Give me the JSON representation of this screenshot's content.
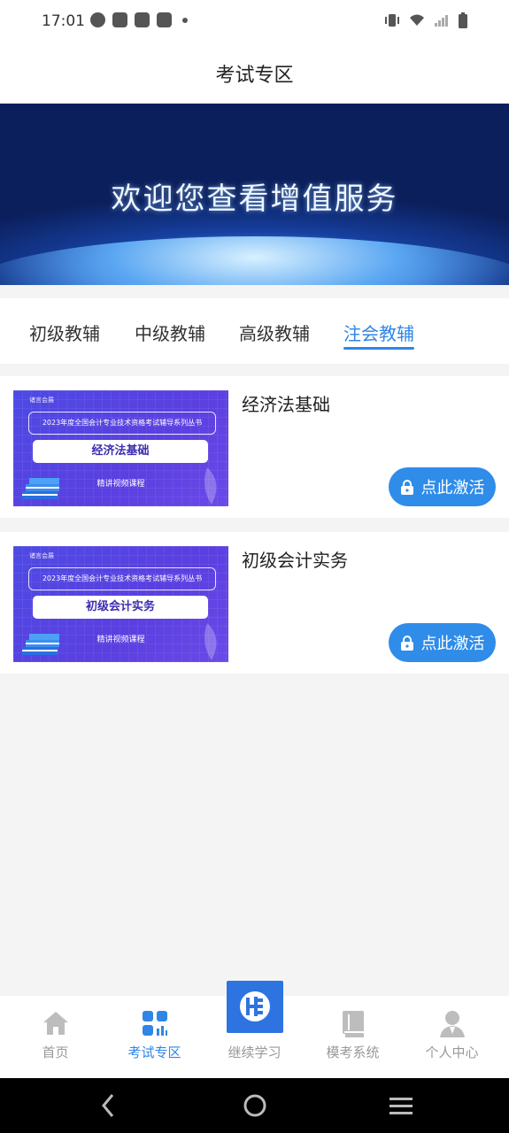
{
  "status_bar": {
    "time": "17:01"
  },
  "header": {
    "title": "考试专区"
  },
  "banner": {
    "text": "欢迎您查看增值服务"
  },
  "tabs": [
    {
      "label": "初级教辅",
      "active": false
    },
    {
      "label": "中级教辅",
      "active": false
    },
    {
      "label": "高级教辅",
      "active": false
    },
    {
      "label": "注会教辅",
      "active": true
    }
  ],
  "courses": [
    {
      "title": "经济法基础",
      "thumb_series": "2023年度全国会计专业技术资格考试辅导系列丛书",
      "thumb_subject": "经济法基础",
      "thumb_sub": "精讲视频课程",
      "thumb_brand": "诸言会展",
      "button": "点此激活"
    },
    {
      "title": "初级会计实务",
      "thumb_series": "2023年度全国会计专业技术资格考试辅导系列丛书",
      "thumb_subject": "初级会计实务",
      "thumb_sub": "精讲视频课程",
      "thumb_brand": "诸言会展",
      "button": "点此激活"
    }
  ],
  "bottom_nav": [
    {
      "label": "首页",
      "icon": "home-icon",
      "active": false
    },
    {
      "label": "考试专区",
      "icon": "grid-chart-icon",
      "active": true
    },
    {
      "label": "继续学习",
      "icon": "app-logo-icon",
      "active": false
    },
    {
      "label": "模考系统",
      "icon": "book-icon",
      "active": false
    },
    {
      "label": "个人中心",
      "icon": "user-icon",
      "active": false
    }
  ],
  "colors": {
    "accent": "#2f86e6",
    "button": "#2f8ce8",
    "thumb": "#5b3fe0"
  }
}
